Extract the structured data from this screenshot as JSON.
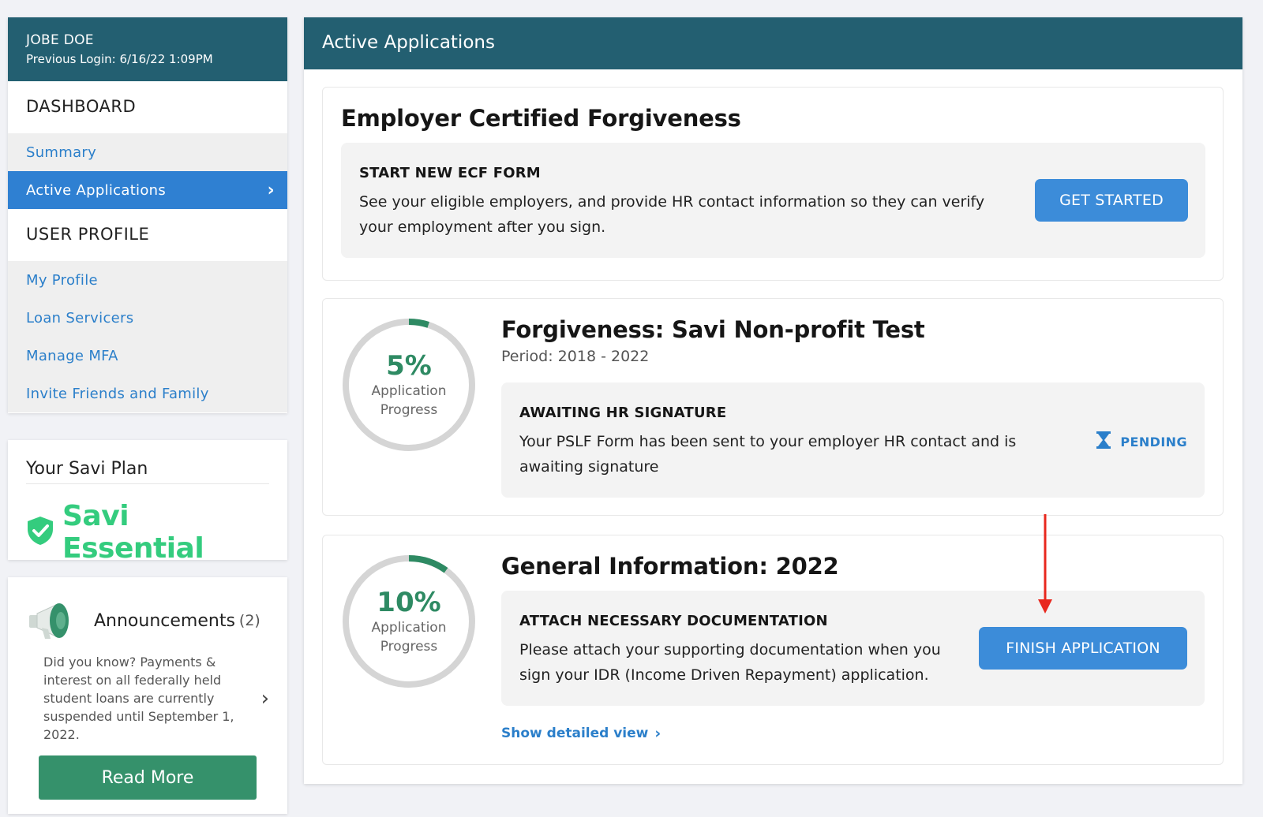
{
  "user": {
    "name": "JOBE DOE",
    "previous_login": "Previous Login: 6/16/22 1:09PM"
  },
  "nav": {
    "dashboard_heading": "DASHBOARD",
    "dashboard_items": [
      {
        "label": "Summary",
        "active": false
      },
      {
        "label": "Active Applications",
        "active": true,
        "chevron": "›"
      }
    ],
    "profile_heading": "USER PROFILE",
    "profile_items": [
      {
        "label": "My Profile"
      },
      {
        "label": "Loan Servicers"
      },
      {
        "label": "Manage MFA"
      },
      {
        "label": "Invite Friends and Family"
      }
    ]
  },
  "plan": {
    "title": "Your Savi Plan",
    "name": "Savi Essential",
    "icon": "shield-check-icon",
    "color": "#34cc7e"
  },
  "announcements": {
    "title": "Announcements",
    "count": "(2)",
    "icon": "megaphone-icon",
    "text": "Did you know? Payments & interest on all federally held student loans are currently suspended until September 1, 2022.",
    "chevron": "›",
    "button_label": "Read More"
  },
  "main": {
    "title": "Active Applications",
    "ecf": {
      "title": "Employer Certified Forgiveness",
      "box_heading": "START NEW ECF FORM",
      "box_text": "See your eligible employers, and provide HR contact information so they can verify your employment after you sign.",
      "button_label": "GET STARTED"
    },
    "forgiveness": {
      "progress": 5,
      "progress_text": "5%",
      "progress_label_1": "Application",
      "progress_label_2": "Progress",
      "title": "Forgiveness: Savi Non-profit Test",
      "period": "Period: 2018 - 2022",
      "box_heading": "AWAITING HR SIGNATURE",
      "box_text": "Your PSLF Form has been sent to your employer HR contact and is awaiting signature",
      "status": "PENDING",
      "status_icon": "hourglass-icon"
    },
    "general": {
      "progress": 10,
      "progress_text": "10%",
      "progress_label_1": "Application",
      "progress_label_2": "Progress",
      "title": "General Information: 2022",
      "box_heading": "ATTACH NECESSARY DOCUMENTATION",
      "box_text": "Please attach your supporting documentation when you sign your IDR (Income Driven Repayment) application.",
      "button_label": "FINISH APPLICATION",
      "link_label": "Show detailed view",
      "link_chevron": "›"
    }
  },
  "colors": {
    "header": "#235f71",
    "accent_blue": "#2f80d2",
    "progress_green": "#2e8a63",
    "read_more_green": "#35916b",
    "annotation_red": "#e8281e"
  }
}
